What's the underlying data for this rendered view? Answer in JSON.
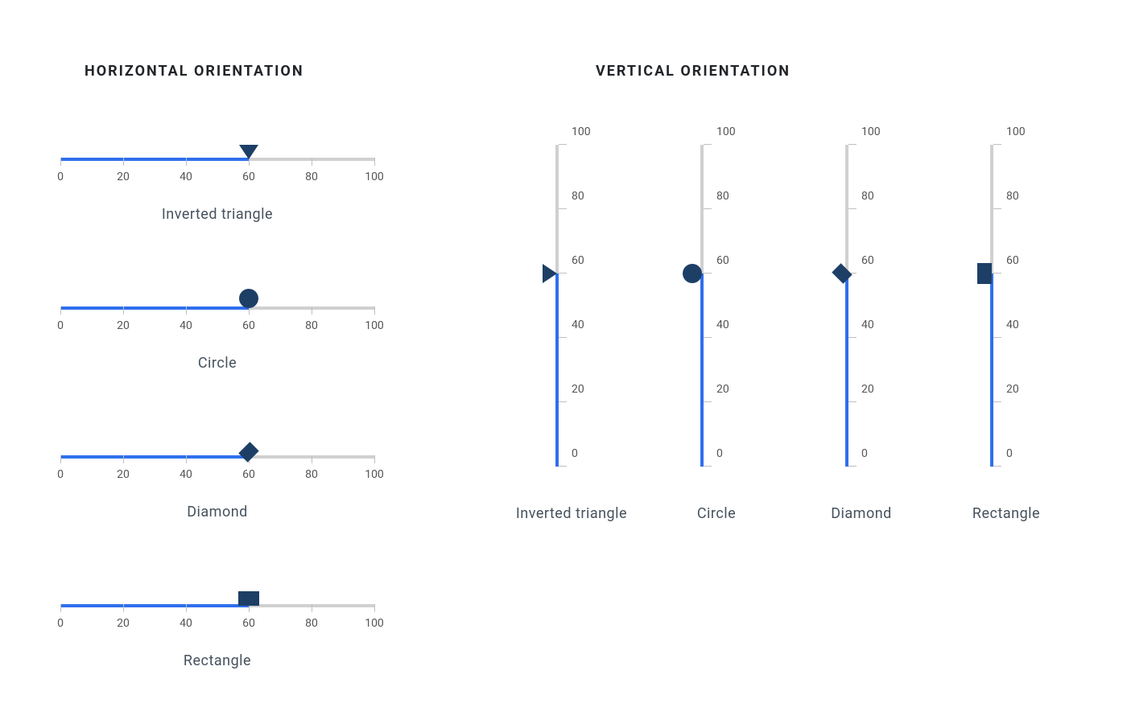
{
  "titles": {
    "horizontal": "HORIZONTAL ORIENTATION",
    "vertical": "VERTICAL ORIENTATION"
  },
  "scale": {
    "min": 0,
    "max": 100,
    "ticks": [
      0,
      20,
      40,
      60,
      80,
      100
    ]
  },
  "colors": {
    "fill": "#2f6fed",
    "rail": "#d0d0d0",
    "handle": "#1d3f66"
  },
  "horizontal": [
    {
      "shape": "inverted-triangle",
      "value": 60,
      "caption": "Inverted triangle"
    },
    {
      "shape": "circle",
      "value": 60,
      "caption": "Circle"
    },
    {
      "shape": "diamond",
      "value": 60,
      "caption": "Diamond"
    },
    {
      "shape": "rectangle",
      "value": 60,
      "caption": "Rectangle"
    }
  ],
  "vertical": [
    {
      "shape": "inverted-triangle",
      "value": 60,
      "caption": "Inverted triangle"
    },
    {
      "shape": "circle",
      "value": 60,
      "caption": "Circle"
    },
    {
      "shape": "diamond",
      "value": 60,
      "caption": "Diamond"
    },
    {
      "shape": "rectangle",
      "value": 60,
      "caption": "Rectangle"
    }
  ],
  "chart_data": {
    "type": "bar",
    "title": "Slider handle shape variations at value=60, horizontal and vertical orientations",
    "categories": [
      "Inverted triangle",
      "Circle",
      "Diamond",
      "Rectangle"
    ],
    "series": [
      {
        "name": "Horizontal",
        "values": [
          60,
          60,
          60,
          60
        ]
      },
      {
        "name": "Vertical",
        "values": [
          60,
          60,
          60,
          60
        ]
      }
    ],
    "xlabel": "",
    "ylabel": "",
    "ylim": [
      0,
      100
    ]
  }
}
